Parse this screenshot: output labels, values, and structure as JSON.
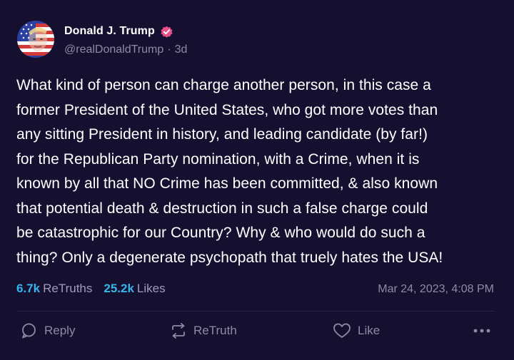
{
  "author": {
    "name": "Donald J. Trump",
    "handle": "@realDonaldTrump",
    "separator": "·",
    "time_ago": "3d",
    "verified_icon": "verified-badge-icon",
    "verified_color": "#e8508a"
  },
  "post": {
    "text": "What kind of person can charge another person, in this case a\nformer President of the United States, who got more votes than\nany sitting President in history, and leading candidate (by far!)\nfor the Republican Party nomination, with a Crime, when it is\nknown by all that NO Crime has been committed, & also known\nthat potential death & destruction in such a false charge could\nbe catastrophic for our Country? Why & who would do such a\nthing? Only a degenerate psychopath that truely hates the USA!"
  },
  "stats": {
    "retruths_count": "6.7k",
    "retruths_label": "ReTruths",
    "likes_count": "25.2k",
    "likes_label": "Likes",
    "timestamp": "Mar 24, 2023, 4:08 PM"
  },
  "actions": {
    "reply_label": "Reply",
    "retruth_label": "ReTruth",
    "like_label": "Like"
  },
  "colors": {
    "background": "#151030",
    "accent": "#36b6ea",
    "muted": "#8e8aa8"
  }
}
